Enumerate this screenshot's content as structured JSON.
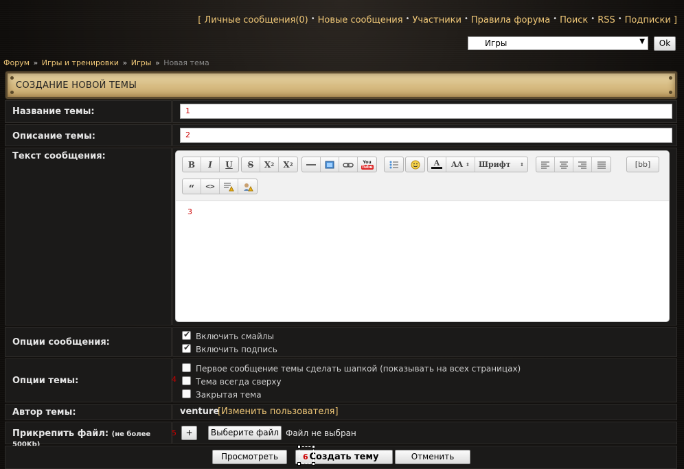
{
  "topnav": {
    "open_bracket": "[",
    "close_bracket": "]",
    "links": [
      {
        "label": "Личные сообщения(0)"
      },
      {
        "label": "Новые сообщения"
      },
      {
        "label": "Участники"
      },
      {
        "label": "Правила форума"
      },
      {
        "label": "Поиск"
      },
      {
        "label": "RSS"
      },
      {
        "label": "Подписки"
      }
    ]
  },
  "forum_jump": {
    "selected": "Игры",
    "ok_label": "Ok"
  },
  "breadcrumb": {
    "items": [
      "Форум",
      "Игры и тренировки",
      "Игры"
    ],
    "separator": "»",
    "current": "Новая тема"
  },
  "header": {
    "title": "СОЗДАНИЕ НОВОЙ ТЕМЫ"
  },
  "form": {
    "title_label": "Название темы:",
    "title_value": "1",
    "desc_label": "Описание темы:",
    "desc_value": "2",
    "message_label": "Текст сообщения:",
    "message_value": "3",
    "editor": {
      "font_size_label": "AA",
      "font_family_label": "Шрифт",
      "bb_label": "[bb]",
      "youtube_top": "You",
      "youtube_bottom": "Tube"
    },
    "msg_options_label": "Опции сообщения:",
    "msg_options": [
      {
        "label": "Включить смайлы",
        "checked": true
      },
      {
        "label": "Включить подпись",
        "checked": true
      }
    ],
    "topic_options_label": "Опции темы:",
    "topic_options_marker": "4",
    "topic_options": [
      {
        "label": "Первое сообщение темы сделать шапкой (показывать на всех страницах)",
        "checked": false
      },
      {
        "label": "Тема всегда сверху",
        "checked": false
      },
      {
        "label": "Закрытая тема",
        "checked": false
      }
    ],
    "author_label": "Автор темы:",
    "author_name": "venture",
    "change_user_label": "Изменить пользователя",
    "attach_label": "Прикрепить файл:",
    "attach_limit": "(не более 500Kb)",
    "attach_marker": "5",
    "add_label": "+",
    "choose_file_label": "Выберите файл",
    "no_file_label": "Файл не выбран"
  },
  "actions": {
    "preview_label": "Просмотреть",
    "submit_marker": "6",
    "submit_label": "Создать тему",
    "cancel_label": "Отменить"
  }
}
